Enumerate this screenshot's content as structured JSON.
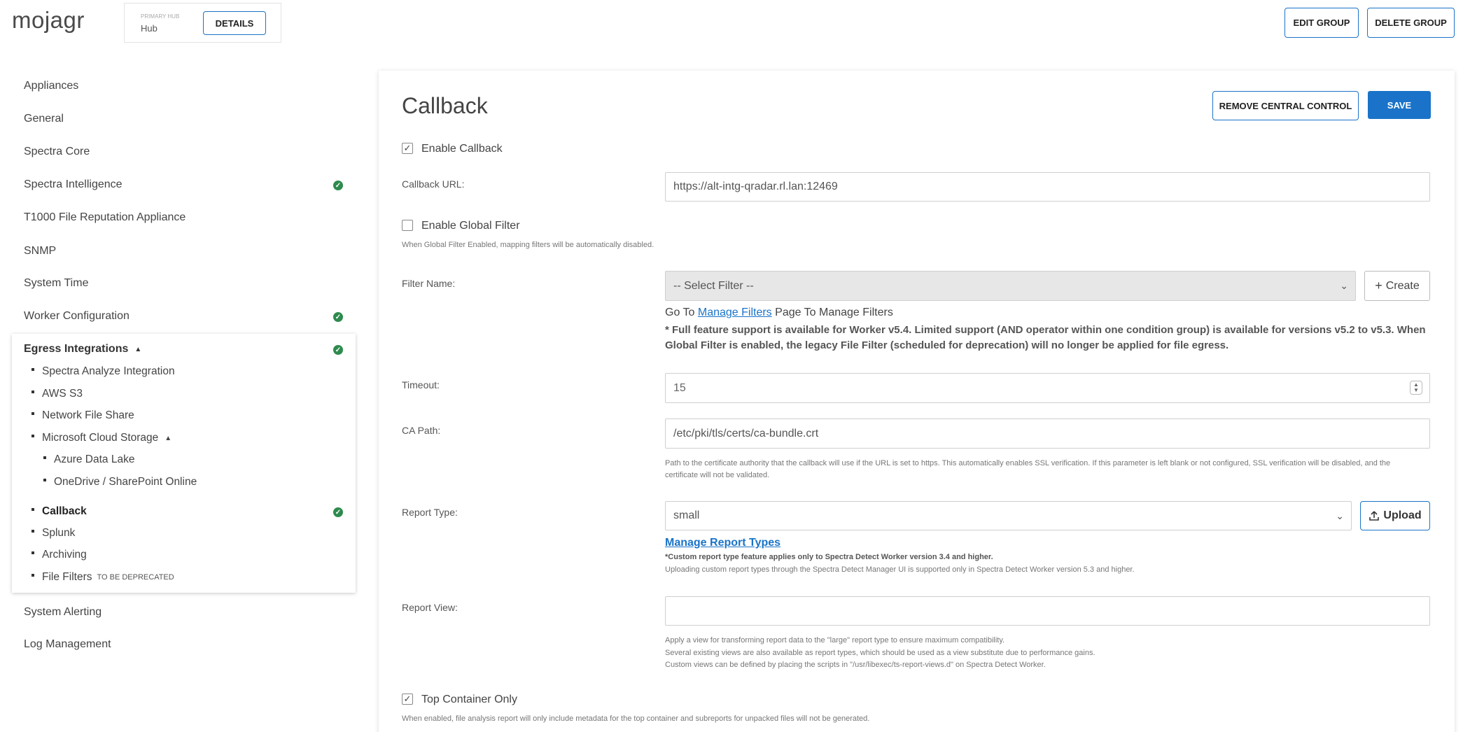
{
  "header": {
    "app_title": "mojagr",
    "hub_caption": "PRIMARY HUB",
    "hub_name": "Hub",
    "details_label": "DETAILS",
    "edit_group_label": "EDIT GROUP",
    "delete_group_label": "DELETE GROUP"
  },
  "sidebar": {
    "items": [
      {
        "label": "Appliances",
        "status": ""
      },
      {
        "label": "General",
        "status": ""
      },
      {
        "label": "Spectra Core",
        "status": ""
      },
      {
        "label": "Spectra Intelligence",
        "status": "check-icon"
      },
      {
        "label": "T1000 File Reputation Appliance",
        "status": ""
      },
      {
        "label": "SNMP",
        "status": ""
      },
      {
        "label": "System Time",
        "status": ""
      },
      {
        "label": "Worker Configuration",
        "status": "check-icon"
      }
    ],
    "egress": {
      "label": "Egress Integrations",
      "expand_icon": "▲",
      "children": [
        {
          "label": "Spectra Analyze Integration"
        },
        {
          "label": "AWS S3"
        },
        {
          "label": "Network File Share"
        },
        {
          "label": "Microsoft Cloud Storage",
          "expand_icon": "▲"
        },
        {
          "label": "Azure Data Lake"
        },
        {
          "label": "OneDrive / SharePoint Online"
        },
        {
          "label": "Callback",
          "active": true
        },
        {
          "label": "Splunk"
        },
        {
          "label": "Archiving"
        },
        {
          "label": "File Filters",
          "tag": "TO BE DEPRECATED"
        }
      ]
    },
    "bottom_items": [
      {
        "label": "System Alerting"
      },
      {
        "label": "Log Management"
      }
    ]
  },
  "main": {
    "title": "Callback",
    "remove_central_control_label": "REMOVE CENTRAL CONTROL",
    "save_label": "SAVE",
    "enable_callback": {
      "label": "Enable Callback",
      "checked": true
    },
    "callback_url": {
      "label": "Callback URL:",
      "value": "https://alt-intg-qradar.rl.lan:12469"
    },
    "enable_global_filter": {
      "label": "Enable Global Filter",
      "checked": false,
      "hint": "When Global Filter Enabled, mapping filters will be automatically disabled."
    },
    "filter_name": {
      "label": "Filter Name:",
      "placeholder": "-- Select Filter --",
      "create_label": "Create",
      "goto_prefix": "Go To",
      "goto_link": "Manage Filters",
      "goto_suffix": "Page To Manage Filters",
      "note": "* Full feature support is available for Worker v5.4. Limited support (AND operator within one condition group) is available for versions v5.2 to v5.3. When Global Filter is enabled, the legacy File Filter (scheduled for deprecation) will no longer be applied for file egress."
    },
    "timeout": {
      "label": "Timeout:",
      "value": "15"
    },
    "ca_path": {
      "label": "CA Path:",
      "value": "/etc/pki/tls/certs/ca-bundle.crt",
      "hint": "Path to the certificate authority that the callback will use if the URL is set to https. This automatically enables SSL verification. If this parameter is left blank or not configured, SSL verification will be disabled, and the certificate will not be validated."
    },
    "report_type": {
      "label": "Report Type:",
      "value": "small",
      "upload_label": "Upload",
      "manage_link": "Manage Report Types",
      "note_bold": "*Custom report type feature applies only to Spectra Detect Worker version 3.4 and higher.",
      "note": "Uploading custom report types through the Spectra Detect Manager UI is supported only in Spectra Detect Worker version 5.3 and higher."
    },
    "report_view": {
      "label": "Report View:",
      "value": "",
      "hint_1": "Apply a view for transforming report data to the \"large\" report type to ensure maximum compatibility.",
      "hint_2": "Several existing views are also available as report types, which should be used as a view substitute due to performance gains.",
      "hint_3": "Custom views can be defined by placing the scripts in \"/usr/libexec/ts-report-views.d\" on Spectra Detect Worker."
    },
    "top_container_only": {
      "label": "Top Container Only",
      "checked": true,
      "hint": "When enabled, file analysis report will only include metadata for the top container and subreports for unpacked files will not be generated."
    }
  },
  "colors": {
    "accent": "#1a73c8",
    "success": "#2e8b4e"
  }
}
